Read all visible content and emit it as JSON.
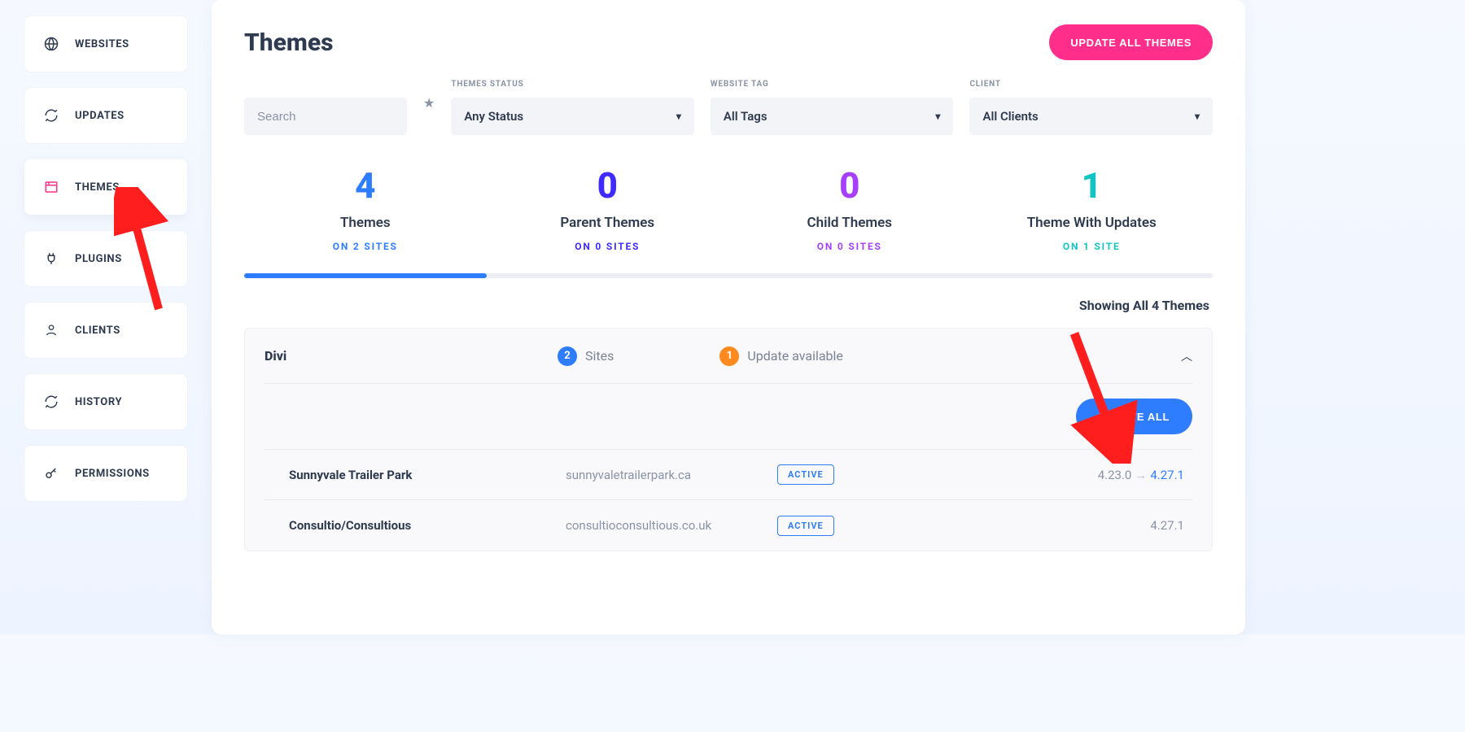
{
  "sidebar": {
    "items": [
      {
        "label": "WEBSITES"
      },
      {
        "label": "UPDATES"
      },
      {
        "label": "THEMES"
      },
      {
        "label": "PLUGINS"
      },
      {
        "label": "CLIENTS"
      },
      {
        "label": "HISTORY"
      },
      {
        "label": "PERMISSIONS"
      }
    ]
  },
  "header": {
    "title": "Themes",
    "update_all_label": "UPDATE ALL THEMES"
  },
  "filters": {
    "search_placeholder": "Search",
    "status": {
      "label": "THEMES STATUS",
      "value": "Any Status"
    },
    "tag": {
      "label": "WEBSITE TAG",
      "value": "All Tags"
    },
    "client": {
      "label": "CLIENT",
      "value": "All Clients"
    }
  },
  "stats": [
    {
      "value": "4",
      "title": "Themes",
      "sub": "ON 2 SITES",
      "color": "blue"
    },
    {
      "value": "0",
      "title": "Parent Themes",
      "sub": "ON 0 SITES",
      "color": "indigo"
    },
    {
      "value": "0",
      "title": "Child Themes",
      "sub": "ON 0 SITES",
      "color": "purple"
    },
    {
      "value": "1",
      "title": "Theme With Updates",
      "sub": "ON 1 SITE",
      "color": "teal"
    }
  ],
  "results": {
    "showing_text": "Showing All 4 Themes"
  },
  "theme_card": {
    "name": "Divi",
    "sites_badge": "2",
    "sites_label": "Sites",
    "updates_badge": "1",
    "updates_label": "Update available",
    "update_all_label": "UPDATE ALL",
    "sites": [
      {
        "name": "Sunnyvale Trailer Park",
        "url": "sunnyvaletrailerpark.ca",
        "status": "ACTIVE",
        "old": "4.23.0",
        "new": "4.27.1",
        "has_update": true
      },
      {
        "name": "Consultio/Consultious",
        "url": "consultioconsultious.co.uk",
        "status": "ACTIVE",
        "old": "",
        "new": "4.27.1",
        "has_update": false
      }
    ]
  }
}
